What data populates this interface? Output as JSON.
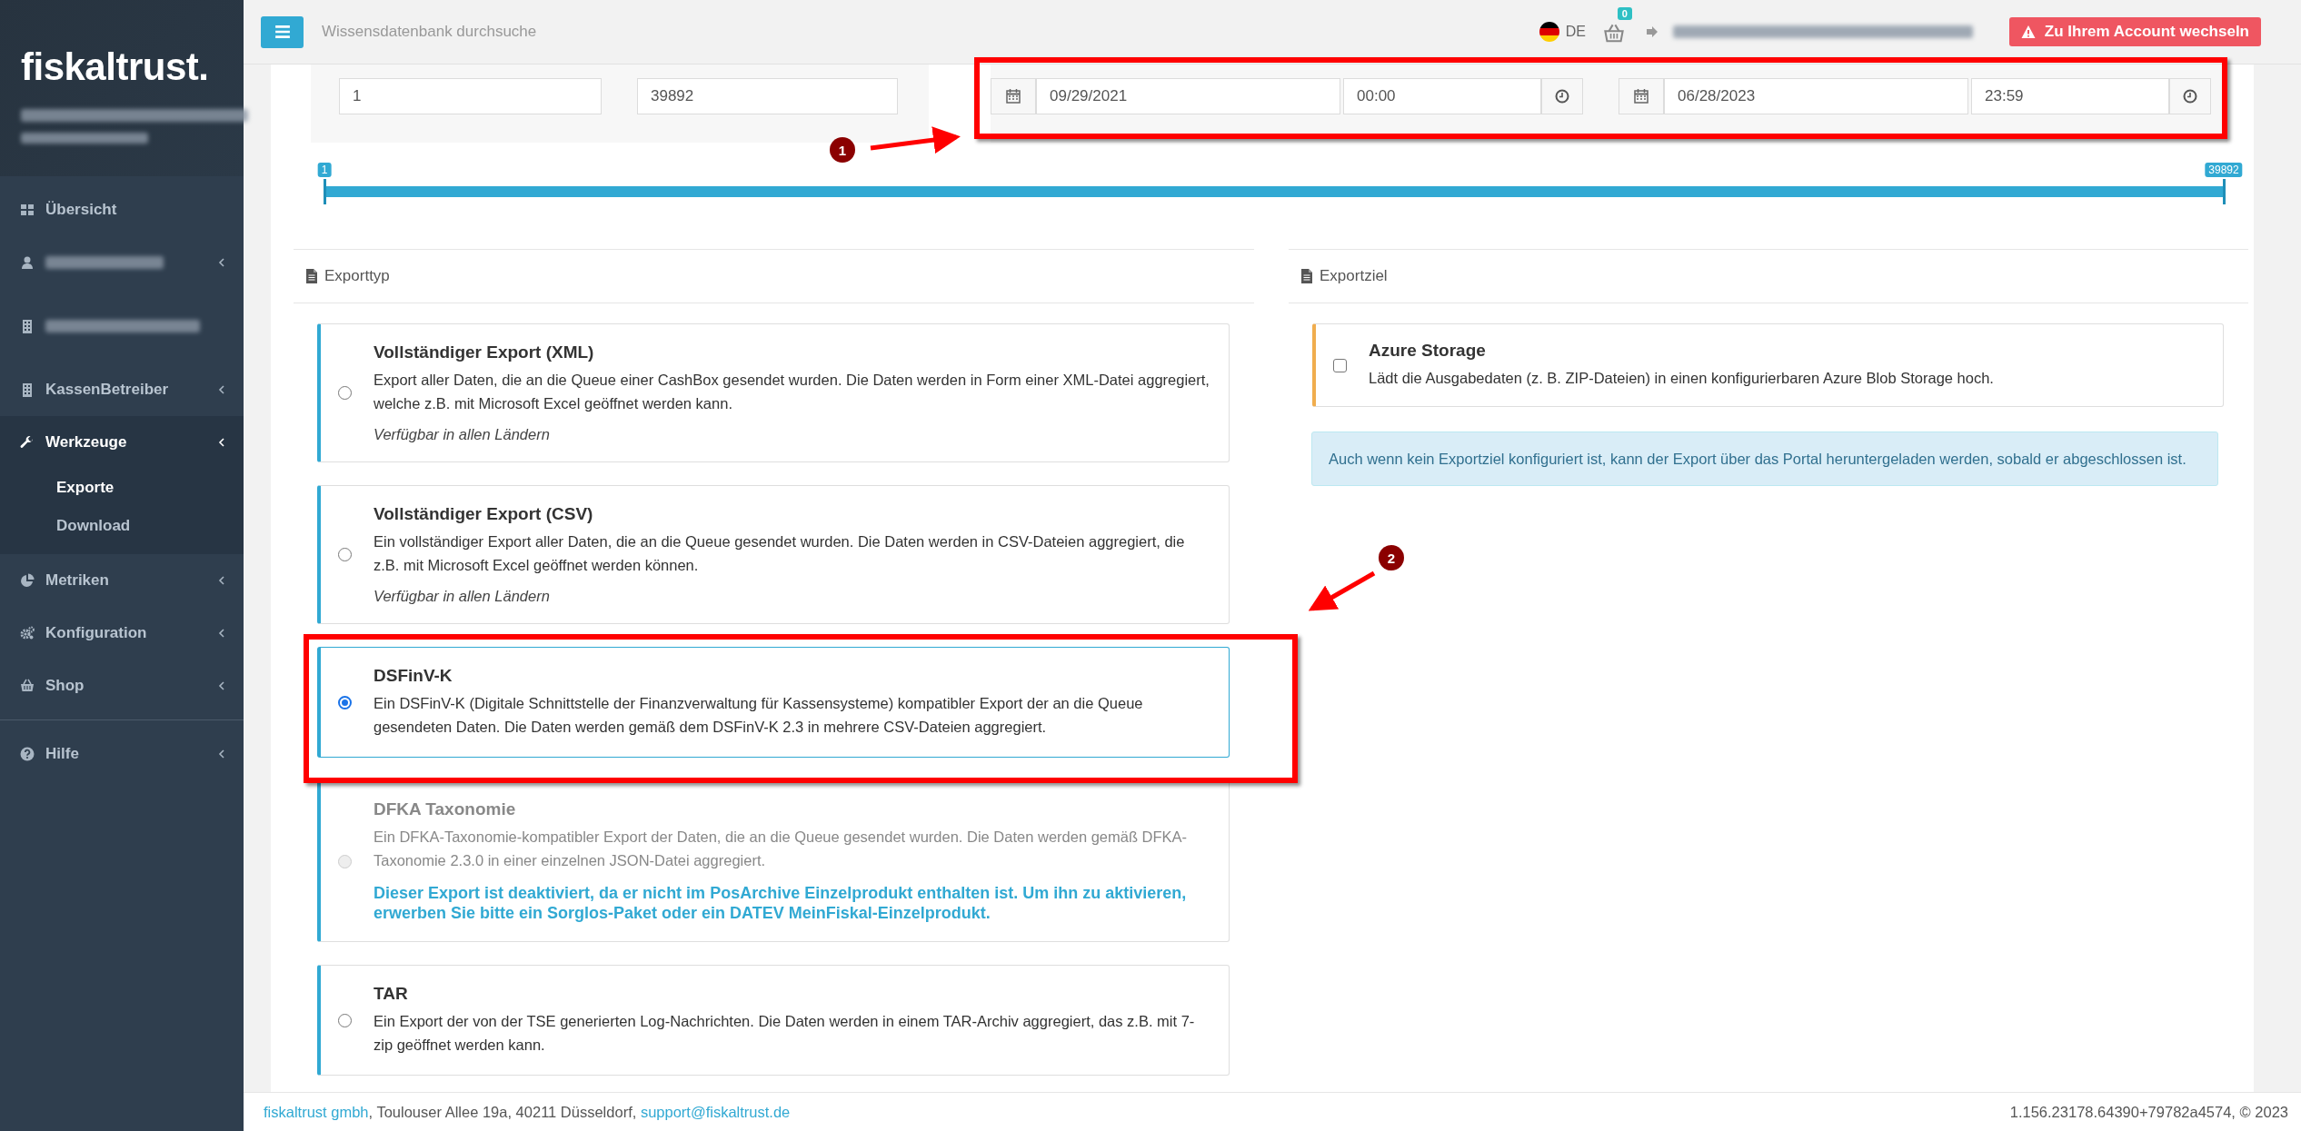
{
  "sidebar": {
    "logo": "fiskaltrust.",
    "nav": [
      {
        "kind": "link",
        "label": "Übersicht",
        "expandable": false
      },
      {
        "kind": "redacted",
        "expandable": true
      },
      {
        "kind": "redacted",
        "expandable": false
      },
      {
        "kind": "link",
        "label": "KassenBetreiber",
        "expandable": true
      },
      {
        "kind": "link",
        "label": "Werkzeuge",
        "expandable": true,
        "expanded": true,
        "children": [
          {
            "label": "Exporte",
            "selected": true
          },
          {
            "label": "Download",
            "selected": false
          }
        ]
      },
      {
        "kind": "link",
        "label": "Metriken",
        "expandable": true
      },
      {
        "kind": "link",
        "label": "Konfiguration",
        "expandable": true
      },
      {
        "kind": "link",
        "label": "Shop",
        "expandable": true
      },
      {
        "kind": "link",
        "label": "Hilfe",
        "expandable": true
      }
    ]
  },
  "topbar": {
    "search": {
      "placeholder": "Wissensdatenbank durchsuche"
    },
    "language": "DE",
    "cart_count": "0",
    "switch_button": "Zu Ihrem Account wechseln"
  },
  "filter": {
    "from": "1",
    "to": "39892",
    "start_date": "09/29/2021",
    "start_time": "00:00",
    "end_date": "06/28/2023",
    "end_time": "23:59",
    "slider": {
      "handles": [
        {
          "label": "1",
          "level": 0
        },
        {
          "label": "39892",
          "level": 1
        }
      ]
    }
  },
  "export_type": {
    "title": "Exporttyp",
    "options": [
      {
        "title": "Vollständiger Export (XML)",
        "description": "Export aller Daten, die an die Queue einer CashBox gesendet wurden. Die Daten werden in Form einer XML-Datei aggregiert, welche z.B. mit Microsoft Excel geöffnet werden kann.",
        "note": "Verfügbar in allen Ländern",
        "selected": false,
        "disabled": false
      },
      {
        "title": "Vollständiger Export (CSV)",
        "description": "Ein vollständiger Export aller Daten, die an die Queue gesendet wurden. Die Daten werden in CSV-Dateien aggregiert, die z.B. mit Microsoft Excel geöffnet werden können.",
        "note": "Verfügbar in allen Ländern",
        "selected": false,
        "disabled": false
      },
      {
        "title": "DSFinV-K",
        "description": "Ein DSFinV-K (Digitale Schnittstelle der Finanzverwaltung für Kassensysteme) kompatibler Export der an die Queue gesendeten Daten. Die Daten werden gemäß dem DSFinV-K 2.3 in mehrere CSV-Dateien aggregiert.",
        "selected": true,
        "disabled": false
      },
      {
        "title": "DFKA Taxonomie",
        "description": "Ein DFKA-Taxonomie-kompatibler Export der Daten, die an die Queue gesendet wurden. Die Daten werden gemäß DFKA-Taxonomie 2.3.0 in einer einzelnen JSON-Datei aggregiert.",
        "notice": "Dieser Export ist deaktiviert, da er nicht im PosArchive Einzelprodukt enthalten ist. Um ihn zu aktivieren, erwerben Sie bitte ein Sorglos-Paket oder ein DATEV MeinFiskal-Einzelprodukt.",
        "selected": false,
        "disabled": true
      },
      {
        "title": "TAR",
        "description": "Ein Export der von der TSE generierten Log-Nachrichten. Die Daten werden in einem TAR-Archiv aggregiert, das z.B. mit 7-zip geöffnet werden kann.",
        "selected": false,
        "disabled": false
      }
    ]
  },
  "export_target": {
    "title": "Exportziel",
    "targets": [
      {
        "title": "Azure Storage",
        "description": "Lädt die Ausgabedaten (z. B. ZIP-Dateien) in einen konfigurierbaren Azure Blob Storage hoch.",
        "checked": false
      }
    ],
    "info": "Auch wenn kein Exportziel konfiguriert ist, kann der Export über das Portal heruntergeladen werden, sobald er abgeschlossen ist."
  },
  "footer": {
    "company": "fiskaltrust gmbh",
    "address": ", Toulouser Allee 19a, 40211 Düsseldorf, ",
    "email": "support@fiskaltrust.de",
    "version": "1.156.23178.64390+79782a4574, © 2023"
  },
  "annotations": [
    {
      "number": "1"
    },
    {
      "number": "2"
    }
  ]
}
